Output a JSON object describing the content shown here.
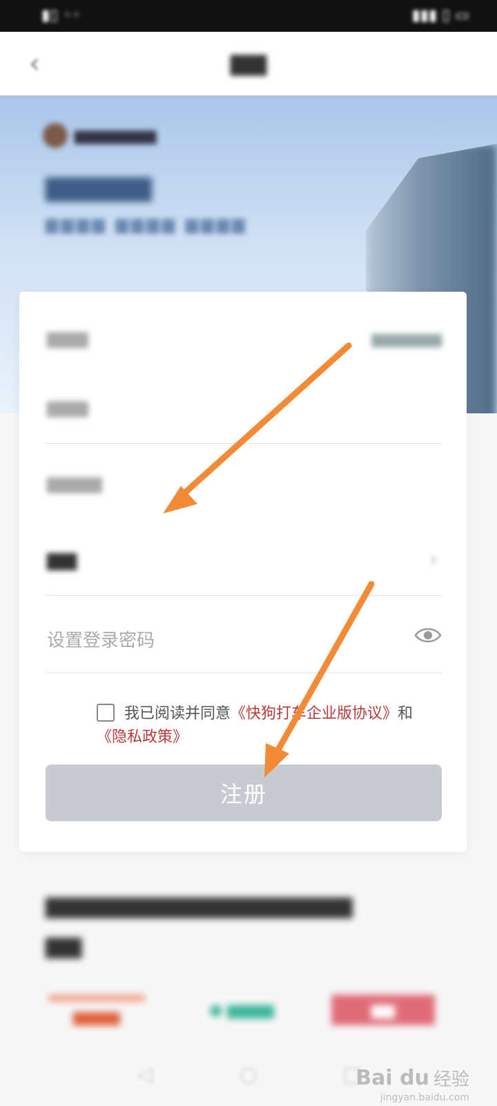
{
  "form": {
    "password_placeholder": "设置登录密码",
    "agree": {
      "prefix": "我已阅读并同意",
      "agreement_link": "《快狗打车企业版协议》",
      "conjunction": "和",
      "privacy_link": "《隐私政策》"
    },
    "register_button": "注册"
  },
  "colors": {
    "link": "#b53a3a",
    "button_disabled": "#c7cad0",
    "arrow": "#f28a36"
  },
  "icons": [
    "back-icon",
    "eye-icon",
    "chevron-right-icon",
    "checkbox-icon"
  ],
  "watermark": {
    "logo": "Bai du",
    "text": "经验",
    "url": "jingyan.baidu.com"
  }
}
